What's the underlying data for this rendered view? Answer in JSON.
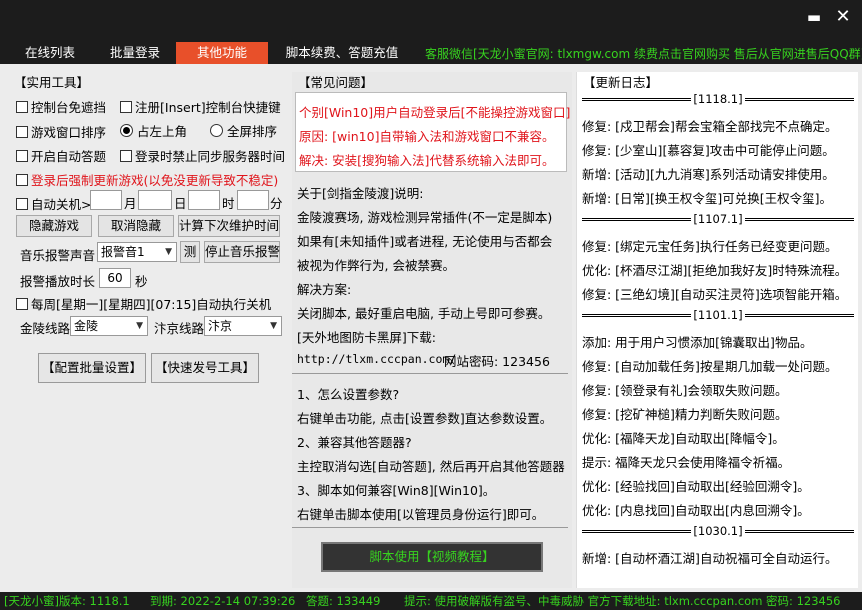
{
  "window": {
    "minimize_label": "▬",
    "close_label": "✕"
  },
  "tabs": [
    {
      "label": "在线列表"
    },
    {
      "label": "批量登录"
    },
    {
      "label": "其他功能"
    },
    {
      "label": "脚本续费、答题充值"
    }
  ],
  "service_text": "客服微信[天龙小蜜官网: tlxmgw.com  续费点击官网购买  售后从官网进售后QQ群]",
  "tools": {
    "title": "【实用工具】",
    "options": [
      {
        "label": "控制台免遮挡",
        "checked": false
      },
      {
        "label": "注册[Insert]控制台快捷键",
        "checked": false
      },
      {
        "label": "游戏窗口排序",
        "checked": false
      },
      {
        "label": "开启自动答题",
        "checked": false
      },
      {
        "label": "登录时禁止同步服务器时间",
        "checked": false
      },
      {
        "label": "登录后强制更新游戏(以免没更新导致不稳定)",
        "checked": false
      }
    ],
    "radio_top": "占左上角",
    "radio_full": "全屏排序",
    "auto_shutdown": "自动关机>",
    "month": "月",
    "day": "日",
    "hour": "时",
    "minute": "分",
    "buttons": {
      "hide_game": "隐藏游戏",
      "cancel_hide": "取消隐藏",
      "calc_maintain": "计算下次维护时间"
    },
    "music_label": "音乐报警声音",
    "music_value": "报警音1",
    "test_btn": "测",
    "stop_music_btn": "停止音乐报警",
    "alarm_duration_label": "报警播放时长",
    "alarm_duration_value": "60",
    "seconds": "秒",
    "weekly_shutdown": "每周[星期一][星期四][07:15]自动执行关机",
    "jinling_label": "金陵线路",
    "jinling_value": "金陵",
    "bianjing_label": "汴京线路",
    "bianjing_value": "汴京",
    "config_batch_btn": "【配置批量设置】",
    "quick_issue_btn": "【快速发号工具】"
  },
  "faq": {
    "title": "【常见问题】",
    "notice": [
      "个别[Win10]用户自动登录后[不能操控游戏窗口]",
      "原因: [win10]自带输入法和游戏窗口不兼容。",
      "解决: 安装[搜狗输入法]代替系统输入法即可。"
    ],
    "lines": [
      "关于[剑指金陵渡]说明:",
      "金陵渡赛场, 游戏检测异常插件(不一定是脚本)",
      "如果有[未知插件]或者进程, 无论使用与否都会",
      "被视为作弊行为, 会被禁赛。",
      "解决方案:",
      "关闭脚本, 最好重启电脑, 手动上号即可参赛。",
      "[天外地图防卡黑屏]下载:"
    ],
    "download_url": "http://tlxm.cccpan.com/",
    "download_pwd": "网站密码: 123456",
    "qa": [
      "1、怎么设置参数?",
      "右键单击功能, 点击[设置参数]直达参数设置。",
      "2、兼容其他答题器?",
      "主控取消勾选[自动答题], 然后再开启其他答题器",
      "3、脚本如何兼容[Win8][Win10]。",
      "右键单击脚本使用[以管理员身份运行]即可。"
    ],
    "video_btn": "脚本使用【视频教程】"
  },
  "changelog": {
    "title": "【更新日志】",
    "sections": [
      {
        "version": "[1118.1]",
        "items": [
          "修复: [戍卫帮会]帮会宝箱全部找完不点确定。",
          "修复: [少室山][慕容复]攻击中可能停止问题。",
          "新增: [活动][九九消寒]系列活动请安排使用。",
          "新增: [日常][换王权令玺]可兑换[王权令玺]。"
        ]
      },
      {
        "version": "[1107.1]",
        "items": [
          "修复: [绑定元宝任务]执行任务已经变更问题。",
          "优化: [杯酒尽江湖][拒绝加我好友]时特殊流程。",
          "修复: [三绝幻境][自动买注灵符]选项智能开箱。"
        ]
      },
      {
        "version": "[1101.1]",
        "items": [
          "添加: 用于用户习惯添加[锦囊取出]物品。",
          "修复: [自动加载任务]按星期几加载一处问题。",
          "修复: [领登录有礼]会领取失败问题。",
          "修复: [挖矿神槌]精力判断失败问题。",
          "优化: [福降天龙]自动取出[降幅令]。",
          "提示: 福降天龙只会使用降福令祈福。",
          "优化: [经验找回]自动取出[经验回溯令]。",
          "优化: [内息找回]自动取出[内息回溯令]。"
        ]
      },
      {
        "version": "[1030.1]",
        "items": [
          "新增: [自动杯酒江湖]自动祝福可全自动运行。"
        ]
      }
    ]
  },
  "statusbar": {
    "version": "[天龙小蜜]版本: 1118.1",
    "expire": "到期: 2022-2-14 07:39:26",
    "answers": "答题: 133449",
    "tip": "提示: 使用破解版有盗号、中毒威胁 官方下载地址: tlxm.cccpan.com 密码: 123456"
  },
  "colors": {
    "accent": "#e8502a",
    "green": "#37d21f",
    "red": "#e0141b",
    "dark": "#1c1c1c"
  }
}
